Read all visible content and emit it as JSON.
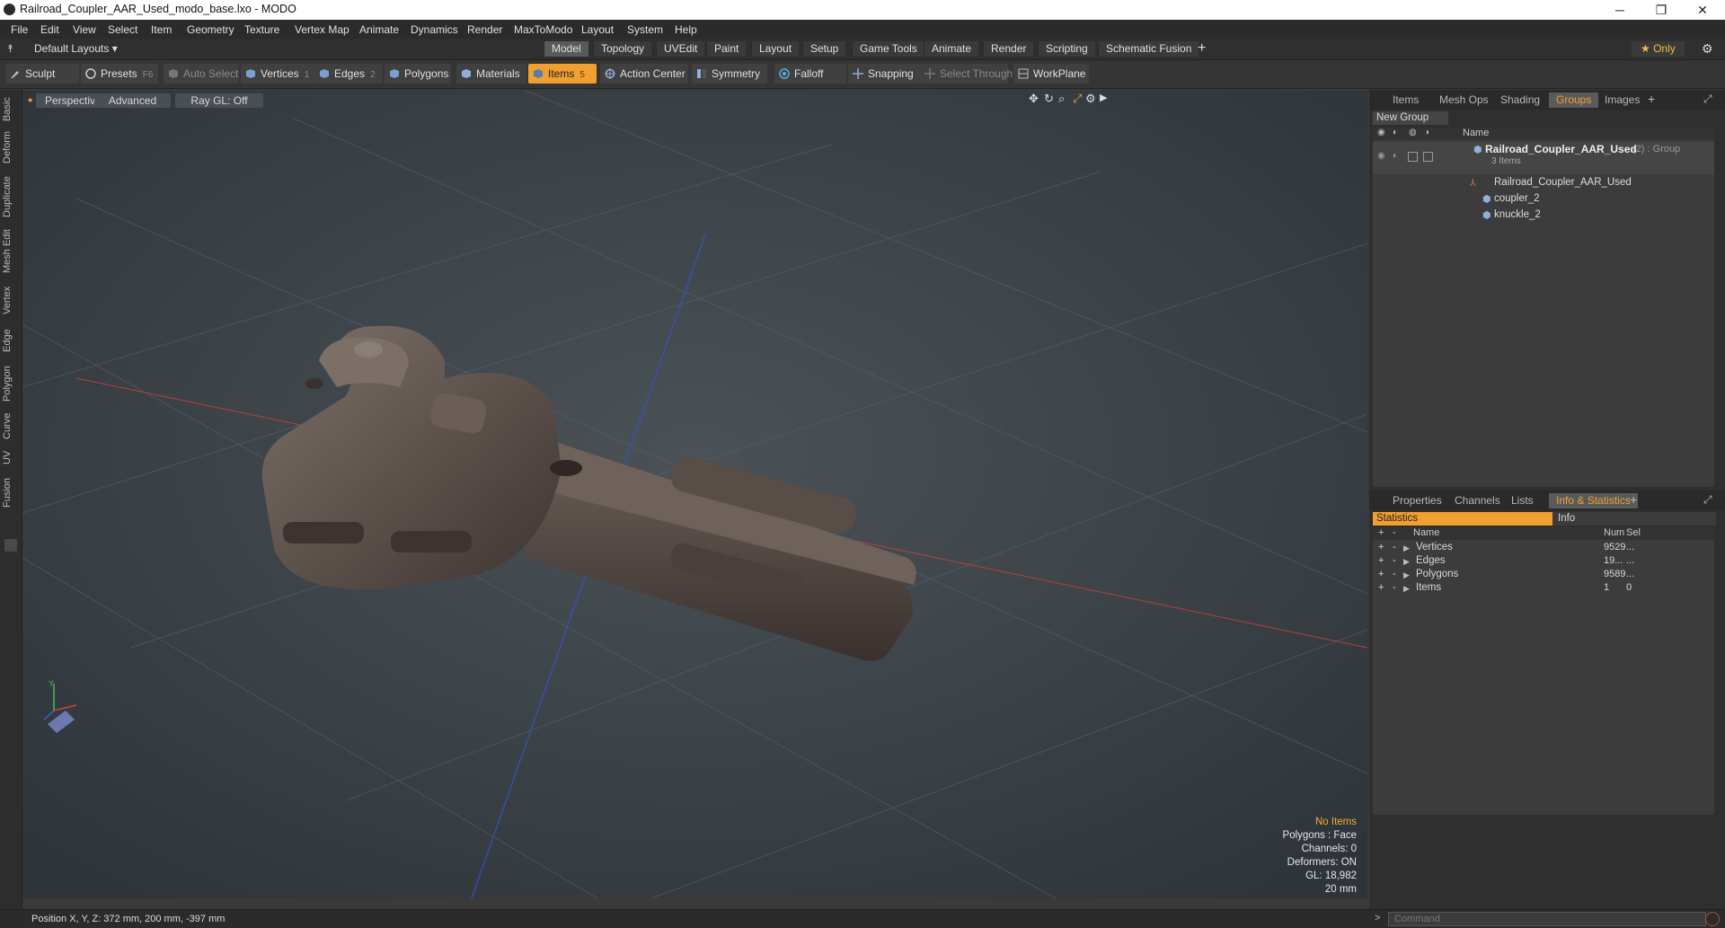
{
  "window": {
    "title": "Railroad_Coupler_AAR_Used_modo_base.lxo - MODO",
    "minimize": "─",
    "maximize": "❐",
    "close": "✕"
  },
  "menu": [
    "File",
    "Edit",
    "View",
    "Select",
    "Item",
    "Geometry",
    "Texture",
    "Vertex Map",
    "Animate",
    "Dynamics",
    "Render",
    "MaxToModo",
    "Layout",
    "System",
    "Help"
  ],
  "layouts": {
    "dropdown": "Default Layouts ▾",
    "tabs": [
      "Model",
      "Topology",
      "UVEdit",
      "Paint",
      "Layout",
      "Setup",
      "Game Tools",
      "Animate",
      "Render",
      "Scripting",
      "Schematic Fusion"
    ],
    "active": "Model",
    "add": "+",
    "only": "★  Only"
  },
  "toolbar": {
    "sculpt": "Sculpt",
    "presets": "Presets",
    "presets_key": "F6",
    "auto_select": "Auto Select",
    "vertices": "Vertices",
    "vertices_key": "1",
    "edges": "Edges",
    "edges_key": "2",
    "polygons": "Polygons",
    "materials": "Materials",
    "items": "Items",
    "items_key": "5",
    "action_center": "Action Center",
    "symmetry": "Symmetry",
    "falloff": "Falloff",
    "snapping": "Snapping",
    "select_through": "Select Through",
    "workplane": "WorkPlane"
  },
  "left_tabs": [
    "Basic",
    "Deform",
    "Duplicate",
    "Mesh Edit",
    "Vertex",
    "Edge",
    "Polygon",
    "Curve",
    "UV",
    "Fusion"
  ],
  "viewport": {
    "view": "Perspective",
    "shading": "Advanced",
    "raygl": "Ray GL: Off",
    "info": {
      "no_items": "No Items",
      "polygons": "Polygons : Face",
      "channels": "Channels: 0",
      "deformers": "Deformers: ON",
      "gl": "GL: 18,982",
      "size": "20 mm"
    },
    "axis_y": "Y"
  },
  "groups_panel": {
    "tabs": [
      "Items",
      "Mesh Ops",
      "Shading",
      "Groups",
      "Images"
    ],
    "active": "Groups",
    "add": "+",
    "new_group": "New Group",
    "col_name": "Name",
    "group_name": "Railroad_Coupler_AAR_Used",
    "group_suffix": "(2) : Group",
    "group_count": "3 Items",
    "children": [
      "Railroad_Coupler_AAR_Used",
      "coupler_2",
      "knuckle_2"
    ]
  },
  "stats_panel": {
    "tabs": [
      "Properties",
      "Channels",
      "Lists",
      "Info & Statistics"
    ],
    "active": "Info & Statistics",
    "add": "+",
    "subtabs": [
      "Statistics",
      "Info"
    ],
    "cols": {
      "name": "Name",
      "num": "Num",
      "sel": "Sel"
    },
    "rows": [
      {
        "name": "Vertices",
        "num": "9529",
        "sel": "..."
      },
      {
        "name": "Edges",
        "num": "19...",
        "sel": "..."
      },
      {
        "name": "Polygons",
        "num": "9589",
        "sel": "..."
      },
      {
        "name": "Items",
        "num": "1",
        "sel": "0"
      }
    ]
  },
  "status": {
    "position": "Position X, Y, Z:   372 mm, 200 mm, -397 mm",
    "command_placeholder": "Command"
  }
}
